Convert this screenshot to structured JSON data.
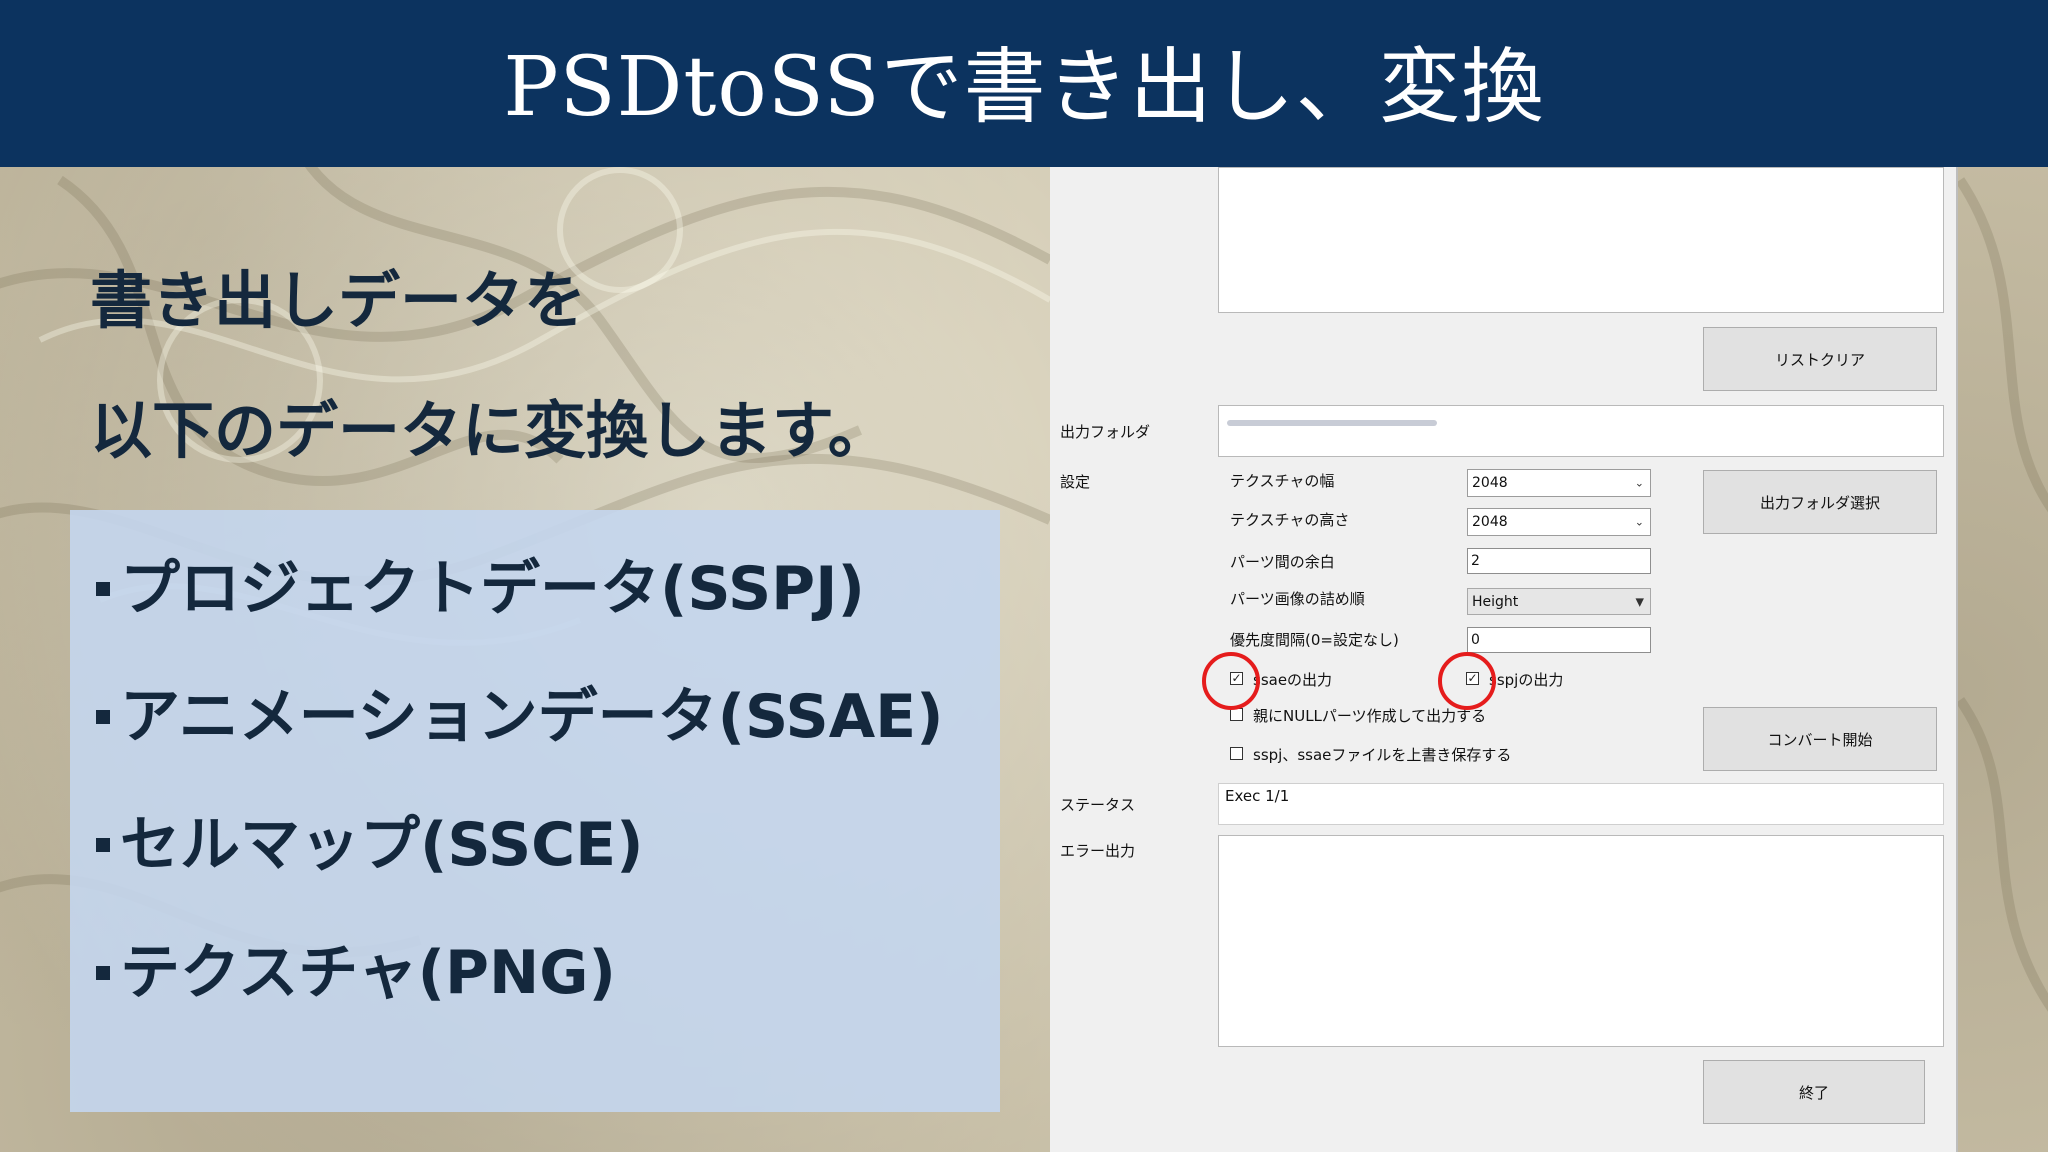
{
  "header": {
    "title": "PSDtoSSで書き出し、変換"
  },
  "intro": {
    "line1": "書き出しデータを",
    "line2": "以下のデータに変換します。"
  },
  "list": {
    "items": [
      "プロジェクトデータ(SSPJ)",
      "アニメーションデータ(SSAE)",
      "セルマップ(SSCE)",
      "テクスチャ(PNG)"
    ]
  },
  "dialog": {
    "list_clear_button": "リストクリア",
    "output_folder_label": "出力フォルダ",
    "settings_label": "設定",
    "texture_width_label": "テクスチャの幅",
    "texture_width_value": "2048",
    "texture_height_label": "テクスチャの高さ",
    "texture_height_value": "2048",
    "parts_margin_label": "パーツ間の余白",
    "parts_margin_value": "2",
    "packing_order_label": "パーツ画像の詰め順",
    "packing_order_value": "Height",
    "priority_interval_label": "優先度間隔(0=設定なし)",
    "priority_interval_value": "0",
    "ssae_output_label": "ssaeの出力",
    "sspj_output_label": "sspjの出力",
    "null_parts_label": "親にNULLパーツ作成して出力する",
    "overwrite_label": "sspj、ssaeファイルを上書き保存する",
    "output_folder_select_button": "出力フォルダ選択",
    "convert_start_button": "コンバート開始",
    "status_label": "ステータス",
    "status_value": "Exec 1/1",
    "error_output_label": "エラー出力",
    "end_button": "終了"
  },
  "colors": {
    "header_bg": "#0c335f",
    "panel_bg": "#c4d6ee",
    "highlight_circle": "#e51c1c",
    "text_dark": "#14283d"
  }
}
